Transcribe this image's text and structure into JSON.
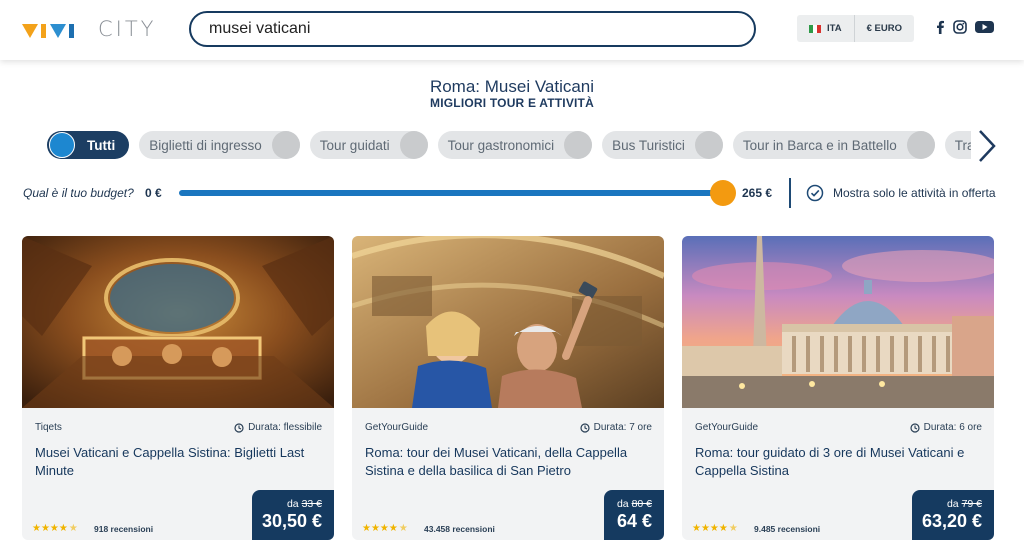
{
  "header": {
    "logo_text": "CITY",
    "search_value": "musei vaticani",
    "language": "ITA",
    "currency": "€ EURO",
    "social_icons": [
      "facebook-icon",
      "instagram-icon",
      "youtube-icon"
    ]
  },
  "page": {
    "title": "Roma: Musei Vaticani",
    "subtitle": "MIGLIORI TOUR E ATTIVITÀ"
  },
  "categories": [
    {
      "label": "Tutti",
      "active": true
    },
    {
      "label": "Biglietti di ingresso",
      "active": false
    },
    {
      "label": "Tour guidati",
      "active": false
    },
    {
      "label": "Tour gastronomici",
      "active": false
    },
    {
      "label": "Bus Turistici",
      "active": false
    },
    {
      "label": "Tour in Barca e in Battello",
      "active": false
    },
    {
      "label": "Trasporti e Trasferimenti",
      "active": false
    }
  ],
  "budget": {
    "label": "Qual è il tuo budget?",
    "min": "0 €",
    "max": "265 €",
    "offer_label": "Mostra solo le attività in offerta"
  },
  "cards": [
    {
      "provider": "Tiqets",
      "duration": "Durata: flessibile",
      "title": "Musei Vaticani e Cappella Sistina: Biglietti Last Minute",
      "price_prefix": "da",
      "price_old": "33 €",
      "price_new": "30,50 €",
      "rating": 4.5,
      "reviews": "918 recensioni"
    },
    {
      "provider": "GetYourGuide",
      "duration": "Durata: 7 ore",
      "title": "Roma: tour dei Musei Vaticani, della Cappella Sistina e della basilica di San Pietro",
      "price_prefix": "da",
      "price_old": "80 €",
      "price_new": "64 €",
      "rating": 4.5,
      "reviews": "43.458 recensioni"
    },
    {
      "provider": "GetYourGuide",
      "duration": "Durata: 6 ore",
      "title": "Roma: tour guidato di 3 ore di Musei Vaticani e Cappella Sistina",
      "price_prefix": "da",
      "price_old": "79 €",
      "price_new": "63,20 €",
      "rating": 4.5,
      "reviews": "9.485 recensioni"
    }
  ],
  "colors": {
    "navy": "#153a60",
    "accent_blue": "#1a76bf",
    "orange": "#f39a10",
    "star": "#f0b400"
  }
}
